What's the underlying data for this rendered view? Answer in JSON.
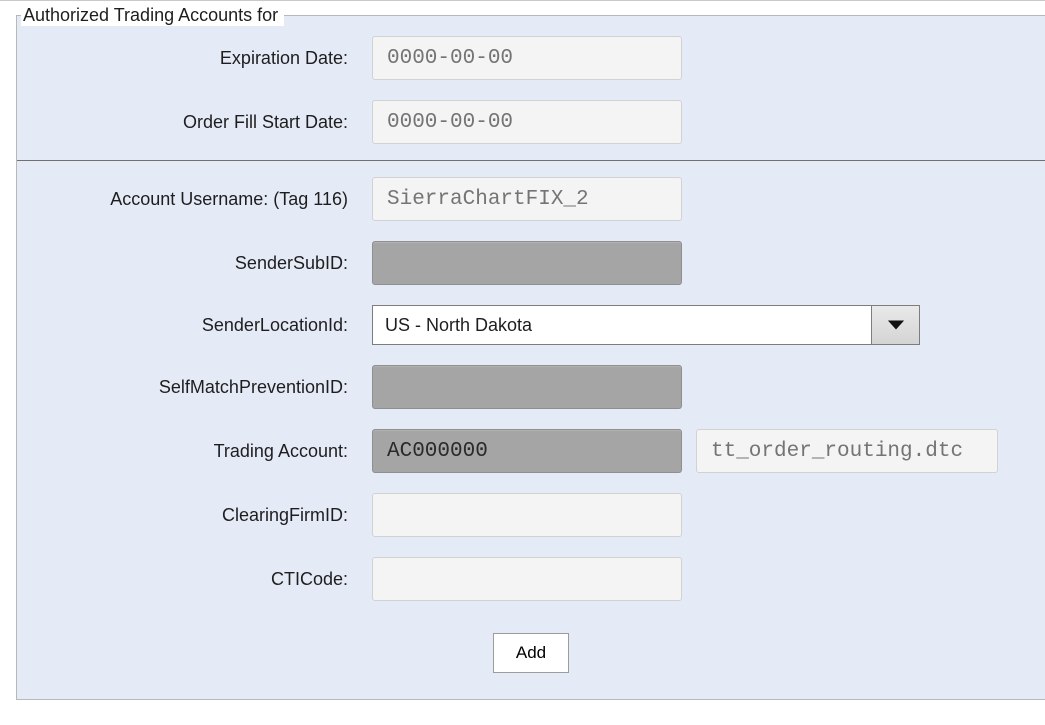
{
  "legend": "Authorized Trading Accounts for",
  "fields": {
    "expiration_date": {
      "label": "Expiration Date:",
      "placeholder": "0000-00-00",
      "value": ""
    },
    "order_fill_start_date": {
      "label": "Order Fill Start Date:",
      "placeholder": "0000-00-00",
      "value": ""
    },
    "account_username": {
      "label": "Account Username: (Tag 116)",
      "placeholder": "SierraChartFIX_2",
      "value": ""
    },
    "sender_sub_id": {
      "label": "SenderSubID:",
      "value": ""
    },
    "sender_location_id": {
      "label": "SenderLocationId:",
      "value": "US - North Dakota"
    },
    "self_match_prevention_id": {
      "label": "SelfMatchPreventionID:",
      "value": ""
    },
    "trading_account": {
      "label": "Trading Account:",
      "value": "AC000000",
      "secondary_placeholder": "tt_order_routing.dtc"
    },
    "clearing_firm_id": {
      "label": "ClearingFirmID:",
      "value": ""
    },
    "cti_code": {
      "label": "CTICode:",
      "value": ""
    }
  },
  "buttons": {
    "add": "Add"
  }
}
